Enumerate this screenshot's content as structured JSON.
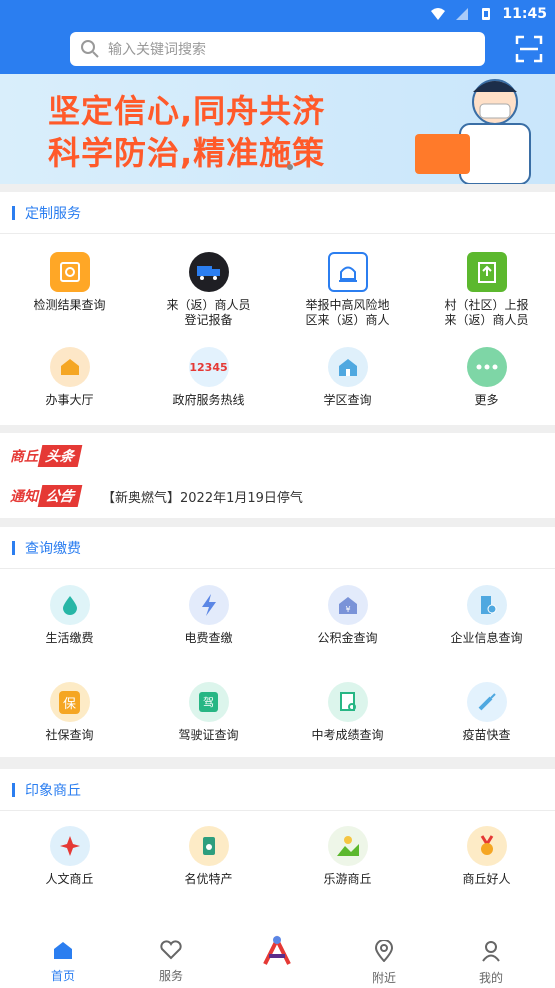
{
  "status": {
    "time": "11:45"
  },
  "search": {
    "placeholder": "输入关键词搜索"
  },
  "banner": {
    "line1": "坚定信心,同舟共济",
    "line2": "科学防治,精准施策"
  },
  "custom": {
    "title": "定制服务",
    "items": [
      {
        "label": "检测结果查询",
        "icon": "search-doc-icon"
      },
      {
        "label": "来（返）商人员\n登记报备",
        "icon": "truck-icon"
      },
      {
        "label": "举报中高风险地\n区来（返）商人",
        "icon": "alarm-icon"
      },
      {
        "label": "村（社区）上报\n来（返）商人员",
        "icon": "clipboard-icon"
      },
      {
        "label": "办事大厅",
        "icon": "house-icon"
      },
      {
        "label": "政府服务热线",
        "icon": "hotline-icon"
      },
      {
        "label": "学区查询",
        "icon": "school-icon"
      },
      {
        "label": "更多",
        "icon": "more-icon"
      }
    ]
  },
  "news": {
    "headline": {
      "a": "商丘",
      "b": "头条"
    },
    "notice": {
      "a": "通知",
      "b": "公告",
      "text": "【新奥燃气】2022年1月19日停气"
    }
  },
  "query": {
    "title": "查询缴费",
    "items": [
      {
        "label": "生活缴费",
        "icon": "water-drop-icon"
      },
      {
        "label": "电费查缴",
        "icon": "lightning-icon"
      },
      {
        "label": "公积金查询",
        "icon": "fund-house-icon"
      },
      {
        "label": "企业信息查询",
        "icon": "building-icon"
      },
      {
        "label": "社保查询",
        "icon": "insurance-icon",
        "glyph": "保"
      },
      {
        "label": "驾驶证查询",
        "icon": "license-icon",
        "glyph": "驾"
      },
      {
        "label": "中考成绩查询",
        "icon": "score-icon"
      },
      {
        "label": "疫苗快查",
        "icon": "syringe-icon"
      }
    ]
  },
  "impression": {
    "title": "印象商丘",
    "items": [
      {
        "label": "人文商丘",
        "icon": "culture-icon"
      },
      {
        "label": "名优特产",
        "icon": "specialty-icon"
      },
      {
        "label": "乐游商丘",
        "icon": "travel-icon"
      },
      {
        "label": "商丘好人",
        "icon": "medal-icon"
      }
    ]
  },
  "nav": [
    {
      "label": "首页",
      "icon": "home-icon"
    },
    {
      "label": "服务",
      "icon": "heart-icon"
    },
    {
      "label": "",
      "icon": "logo-icon"
    },
    {
      "label": "附近",
      "icon": "location-icon"
    },
    {
      "label": "我的",
      "icon": "user-icon"
    }
  ],
  "colors": {
    "primary": "#2b7ef0",
    "banner_text": "#ff5a2a",
    "news_red": "#e53935"
  }
}
